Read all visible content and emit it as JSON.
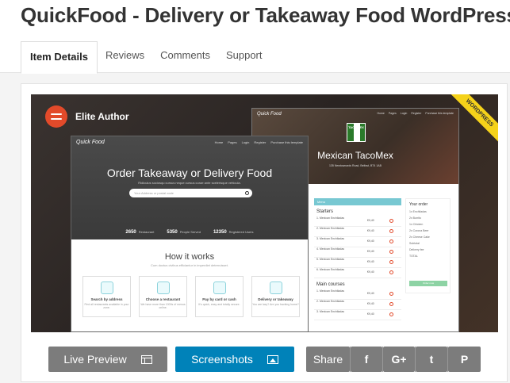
{
  "page": {
    "title": "QuickFood - Delivery or Takeaway Food WordPress"
  },
  "tabs": [
    {
      "label": "Item Details"
    },
    {
      "label": "Reviews"
    },
    {
      "label": "Comments"
    },
    {
      "label": "Support"
    }
  ],
  "banner": {
    "author_badge": "Elite Author",
    "ribbon": "WORDPRESS",
    "home": {
      "logo": "Quick Food",
      "nav": [
        "Home",
        "Pages",
        "Login",
        "Register",
        "Purchase this template"
      ],
      "heading": "Order Takeaway or Delivery Food",
      "subheading": "Ridiculus sociosqu cursus neque cursus curae ante scelerisque vehicula.",
      "search_placeholder": "Your Address or postal code",
      "stats": [
        {
          "value": "2650",
          "label": "Restaurant"
        },
        {
          "value": "5350",
          "label": "People Served"
        },
        {
          "value": "12350",
          "label": "Registered Users"
        }
      ],
      "how_title": "How it works",
      "how_sub": "Cum doctus civibus efficiantur in imperdiet deterruisset.",
      "steps": [
        {
          "title": "Search by address",
          "desc": "Find all restaurants available in your zone."
        },
        {
          "title": "Choose a restaurant",
          "desc": "We have more than 1000s of menus online."
        },
        {
          "title": "Pay by card or cash",
          "desc": "It's quick, easy and totally secure."
        },
        {
          "title": "Delivery or takeaway",
          "desc": "You are lazy? Are you backing home?"
        }
      ]
    },
    "detail": {
      "logo": "Quick Food",
      "nav": [
        "Home",
        "Pages",
        "Login",
        "Register",
        "Purchase this template"
      ],
      "brand": "TACOMEX",
      "name": "Mexican TacoMex",
      "address": "135 Newtownards Road, Belfast, BT4 1AB",
      "menu_bar": "Menu",
      "sections": [
        {
          "title": "Starters",
          "rows": [
            {
              "item": "1. Mexican Enchiladas",
              "price": "€9,40"
            },
            {
              "item": "2. Mexican Enchiladas",
              "price": "€9,40"
            },
            {
              "item": "3. Mexican Enchiladas",
              "price": "€9,40"
            },
            {
              "item": "4. Mexican Enchiladas",
              "price": "€9,40"
            },
            {
              "item": "5. Mexican Enchiladas",
              "price": "€9,40"
            },
            {
              "item": "6. Mexican Enchiladas",
              "price": "€9,40"
            }
          ]
        },
        {
          "title": "Main courses",
          "rows": [
            {
              "item": "1. Mexican Enchiladas",
              "price": "€9,40"
            },
            {
              "item": "2. Mexican Enchiladas",
              "price": "€9,40"
            },
            {
              "item": "3. Mexican Enchiladas",
              "price": "€9,40"
            }
          ]
        }
      ],
      "order": {
        "title": "Your order",
        "lines": [
          "1x Enchiladas",
          "2x Burrito",
          "1x Chicken",
          "2x Corona Beer",
          "2x Cheese Cake"
        ],
        "subtotal": "Subtotal",
        "delivery": "Delivery fee",
        "total": "TOTAL",
        "button": "Order now"
      }
    }
  },
  "actions": {
    "live_preview": "Live Preview",
    "screenshots": "Screenshots",
    "share": "Share",
    "facebook": "f",
    "google_plus": "G+",
    "twitter": "t",
    "pinterest": "P"
  },
  "colors": {
    "accent_blue": "#0082b9",
    "button_gray": "#7c7c7c",
    "elite_red": "#e24a2a",
    "ribbon_yellow": "#f5d21a"
  }
}
